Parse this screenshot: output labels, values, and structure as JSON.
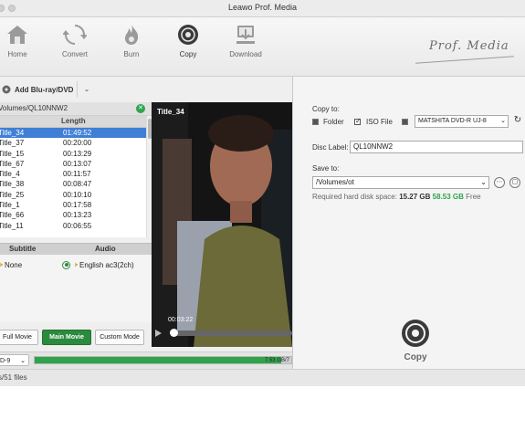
{
  "window": {
    "title": "Leawo Prof. Media"
  },
  "toolbar": {
    "items": [
      {
        "label": "Home",
        "icon": "home-icon"
      },
      {
        "label": "Convert",
        "icon": "convert-icon"
      },
      {
        "label": "Burn",
        "icon": "burn-icon"
      },
      {
        "label": "Copy",
        "icon": "copy-disc-icon"
      },
      {
        "label": "Download",
        "icon": "download-icon"
      }
    ],
    "brand": "Prof. Media"
  },
  "source": {
    "add_label": "Add Blu-ray/DVD",
    "path": "Volumes/QL10NNW2"
  },
  "title_list": {
    "headers": {
      "length": "Length"
    },
    "rows": [
      {
        "title": "Title_34",
        "length": "01:49:52",
        "selected": true
      },
      {
        "title": "Title_37",
        "length": "00:20:00"
      },
      {
        "title": "Title_15",
        "length": "00:13:29"
      },
      {
        "title": "Title_67",
        "length": "00:13:07"
      },
      {
        "title": "Title_4",
        "length": "00:11:57"
      },
      {
        "title": "Title_38",
        "length": "00:08:47"
      },
      {
        "title": "Title_25",
        "length": "00:10:10"
      },
      {
        "title": "Title_1",
        "length": "00:17:58"
      },
      {
        "title": "Title_66",
        "length": "00:13:23"
      },
      {
        "title": "Title_11",
        "length": "00:06:55"
      }
    ]
  },
  "tracks": {
    "subtitle_header": "Subtitle",
    "audio_header": "Audio",
    "subtitle_value": "None",
    "audio_value": "English ac3(2ch)"
  },
  "modes": {
    "full": "Full Movie",
    "main": "Main Movie",
    "custom": "Custom Mode"
  },
  "preview": {
    "title": "Title_34",
    "time": "00:03:22"
  },
  "disc_size": {
    "selected": "D-9",
    "used_text": "7.53 GB/7",
    "fill_fraction": 0.96
  },
  "status": {
    "text": "s/51 files"
  },
  "copy_to": {
    "label": "Copy to:",
    "folder_label": "Folder",
    "iso_label": "ISO File",
    "drive": "MATSHITA DVD-R   UJ-8"
  },
  "disc_label": {
    "label": "Disc Label:",
    "value": "QL10NNW2"
  },
  "save_to": {
    "label": "Save to:",
    "path": "/Volumes/ot",
    "space_label": "Required hard disk space:",
    "required": "15.27 GB",
    "free": "58.53 GB",
    "free_label": "Free"
  },
  "copy_button": {
    "label": "Copy"
  },
  "colors": {
    "accent_green": "#2b8a3e",
    "selection_blue": "#3f7fd6",
    "free_green": "#2fa34a"
  }
}
